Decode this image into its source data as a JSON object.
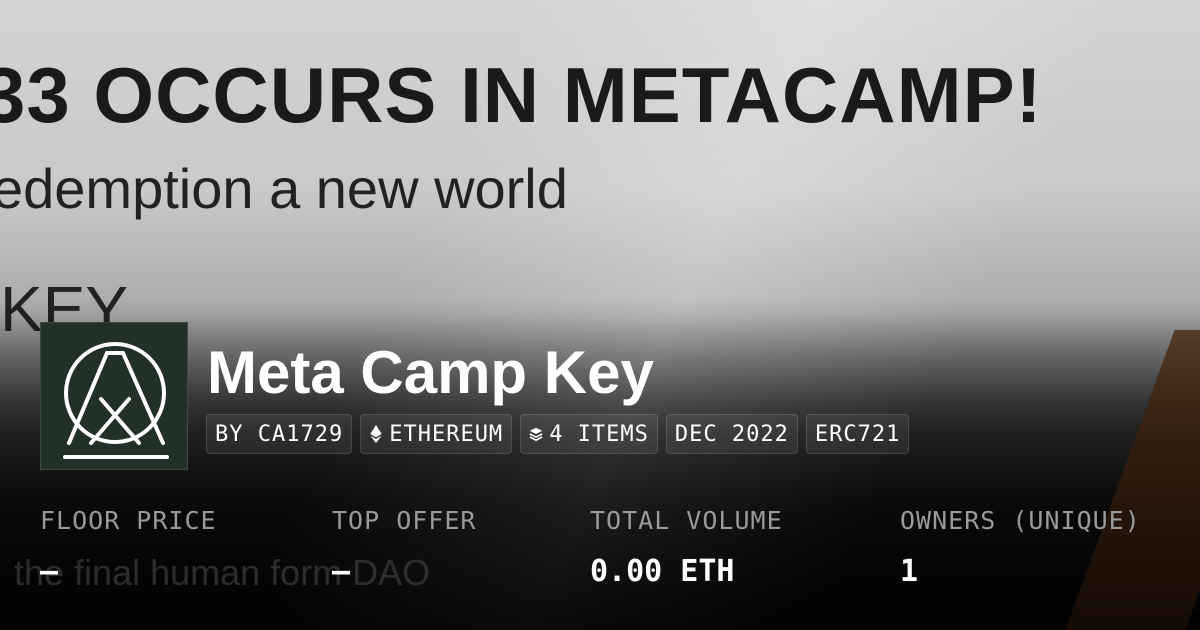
{
  "banner": {
    "line1": "33 OCCURS IN METACAMP!",
    "line2": "edemption  a new world",
    "line3": "KEY",
    "line4": "the final human form DAO"
  },
  "collection": {
    "name": "Meta Camp Key",
    "logo_icon": "tent-in-circle-logo",
    "logo_color": "#213128"
  },
  "badges": [
    {
      "label": "BY CA1729"
    },
    {
      "label": "ETHEREUM",
      "icon": "ethereum-icon"
    },
    {
      "label": "4 ITEMS",
      "icon": "layers-icon"
    },
    {
      "label": "DEC 2022"
    },
    {
      "label": "ERC721"
    }
  ],
  "stats": [
    {
      "label": "FLOOR PRICE",
      "value": "—"
    },
    {
      "label": "TOP OFFER",
      "value": "—"
    },
    {
      "label": "TOTAL VOLUME",
      "value": "0.00 ETH"
    },
    {
      "label": "OWNERS (UNIQUE)",
      "value": "1"
    }
  ]
}
